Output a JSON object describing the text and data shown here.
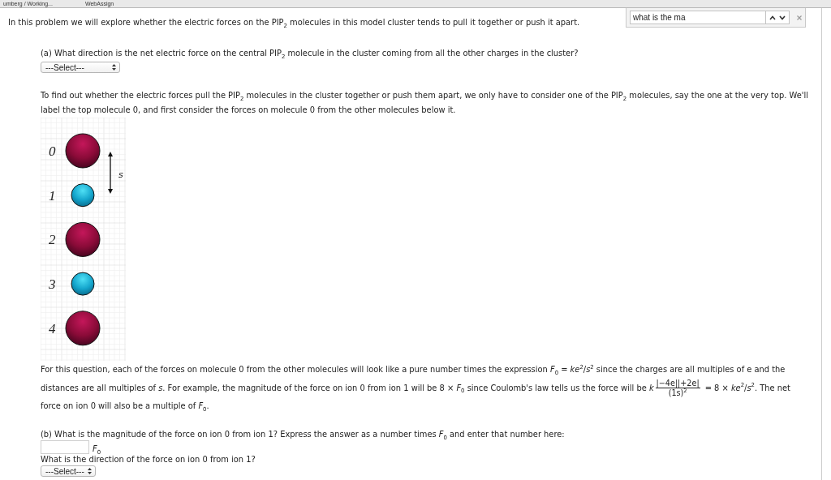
{
  "browser_tabs": [
    {
      "label": "umberg / Working..."
    },
    {
      "label": "WebAssign"
    }
  ],
  "find_bar": {
    "value": "what is the ma"
  },
  "intro": "In this problem we will explore whether the electric forces on the PIP$_{2}$ molecules in this model cluster tends to pull it together or push it apart.",
  "part_a": {
    "question": "(a) What direction is the net electric force on the central PIP$_{2}$ molecule in the cluster coming from all the other charges in the cluster?",
    "select": "---Select---"
  },
  "setup_lines": [
    "To find out whether the electric forces pull the PIP$_{2}$ molecules in the cluster together or push them apart, we only have to consider one of the PIP$_{2}$ molecules, say the one at the very top. We'll",
    "label the top molecule 0, and first consider the forces on molecule 0 from the other molecules below it."
  ],
  "figure": {
    "molecules": [
      {
        "label": "0",
        "kind": "large"
      },
      {
        "label": "1",
        "kind": "small"
      },
      {
        "label": "2",
        "kind": "large"
      },
      {
        "label": "3",
        "kind": "small"
      },
      {
        "label": "4",
        "kind": "large"
      }
    ],
    "spacing_label": "s"
  },
  "explanation": {
    "line_1": "For this question, each of the forces on molecule 0 from the other molecules will look like a pure number times the expression *F*$_{0}$ = *ke*$^{2}$/*s*$^{2}$ since the charges are all multiples of e and the",
    "line_2_before": "distances are all multiples of *s*. For example, the magnitude of the force on ion 0 from ion 1 will be 8 × *F*$_{0}$ since Coulomb's law tells us the force will be  *k*",
    "numerator": "|−4e||+2e|",
    "denominator": "(1s)$^{2}$",
    "line_2_after": "= 8 × *ke*$^{2}$/*s*$^{2}$. The net",
    "line_3": "force on ion 0 will also be a multiple of *F*$_{0}$."
  },
  "part_b": {
    "question": "(b) What is the magnitude of the force on ion 0 from ion 1? Express the answer as a number times *F*$_{0}$ and enter that number here:",
    "unit": "*F*$_{0}$",
    "direction_question": "What is the direction of the force on ion 0 from ion 1?",
    "select": "---Select---"
  }
}
